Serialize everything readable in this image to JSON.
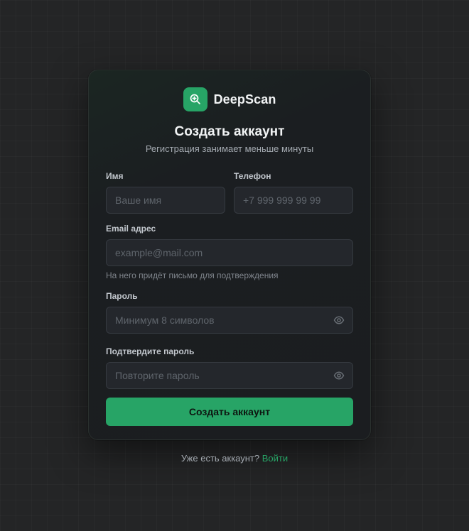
{
  "brand": {
    "name": "DeepScan",
    "logo_icon": "search-zoom-icon",
    "accent_color": "#27a466"
  },
  "header": {
    "title": "Создать аккаунт",
    "subtitle": "Регистрация занимает меньше минуты"
  },
  "form": {
    "name": {
      "label": "Имя",
      "placeholder": "Ваше имя",
      "value": ""
    },
    "phone": {
      "label": "Телефон",
      "placeholder": "+7 999 999 99 99",
      "value": ""
    },
    "email": {
      "label": "Email адрес",
      "placeholder": "example@mail.com",
      "value": "",
      "hint": "На него придёт письмо для подтверждения"
    },
    "password": {
      "label": "Пароль",
      "placeholder": "Минимум 8 символов",
      "value": "",
      "toggle_icon": "eye-icon"
    },
    "confirm": {
      "label": "Подтвердите пароль",
      "placeholder": "Повторите пароль",
      "value": "",
      "toggle_icon": "eye-icon"
    },
    "submit_label": "Создать аккаунт"
  },
  "footer": {
    "text": "Уже есть аккаунт?",
    "link_label": "Войти"
  }
}
